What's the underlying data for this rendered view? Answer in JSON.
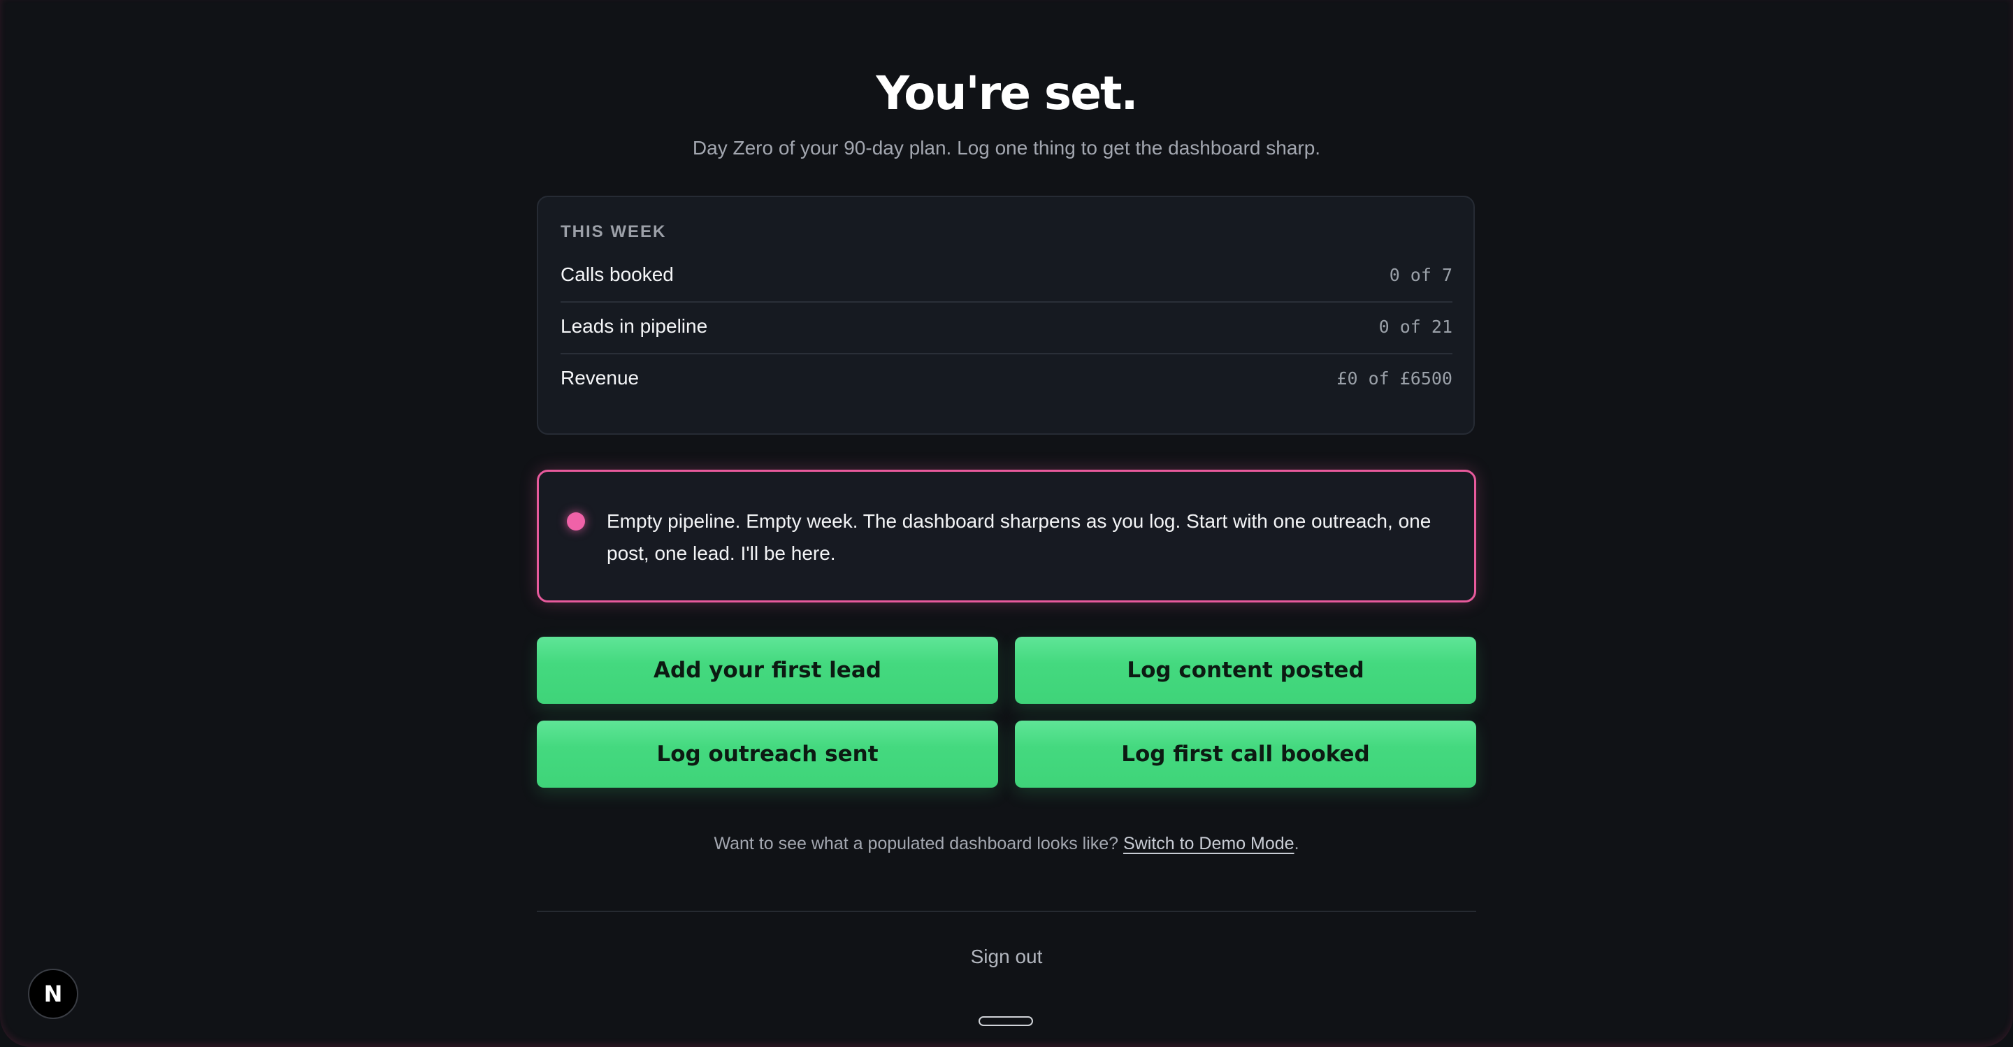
{
  "header": {
    "title": "You're set.",
    "subtitle": "Day Zero of your 90-day plan. Log one thing to get the dashboard sharp."
  },
  "this_week": {
    "label": "THIS WEEK",
    "rows": [
      {
        "label": "Calls booked",
        "value": "0 of 7"
      },
      {
        "label": "Leads in pipeline",
        "value": "0 of 21"
      },
      {
        "label": "Revenue",
        "value": "£0 of £6500"
      }
    ]
  },
  "alert": {
    "message": "Empty pipeline. Empty week. The dashboard sharpens as you log. Start with one outreach, one post, one lead. I'll be here.",
    "dot_color": "#f062a8"
  },
  "actions": {
    "add_lead": "Add your first lead",
    "log_content": "Log content posted",
    "log_outreach": "Log outreach sent",
    "log_call": "Log first call booked",
    "accent": "#44d97f"
  },
  "demo": {
    "prompt": "Want to see what a populated dashboard looks like?",
    "link": "Switch to Demo Mode",
    "suffix": "."
  },
  "footer": {
    "sign_out": "Sign out",
    "badge": "N"
  }
}
